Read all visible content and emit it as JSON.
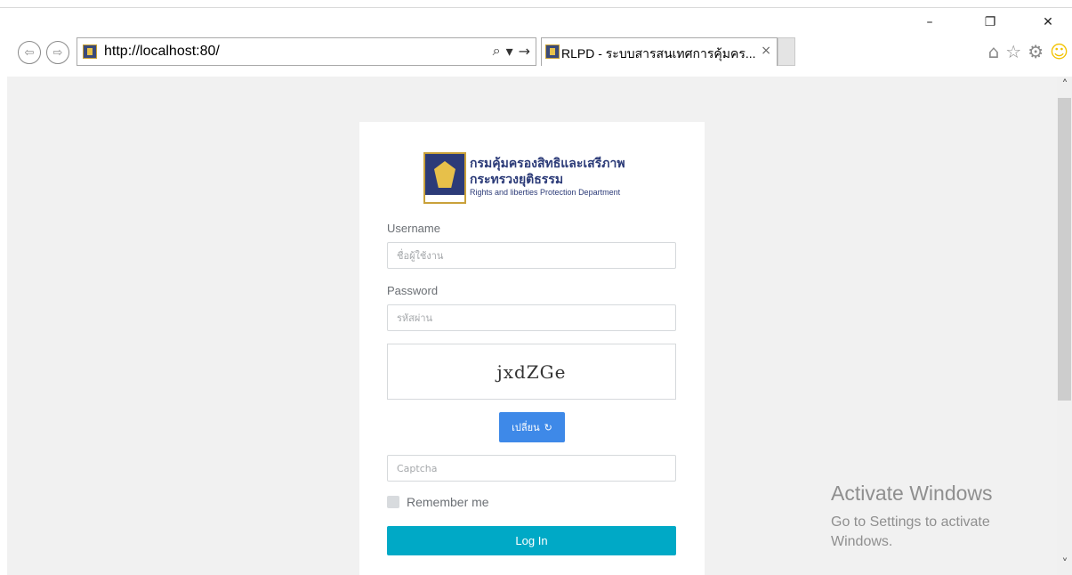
{
  "window": {
    "minimize": "–",
    "restore": "❐",
    "close": "✕"
  },
  "browser": {
    "back_icon": "⇦",
    "forward_icon": "⇨",
    "address": "http://localhost:80/",
    "search_icon": "⌕",
    "dropdown_icon": "▾",
    "go_icon": "→",
    "tab_title": "RLPD - ระบบสารสนเทศการคุ้มคร...",
    "tab_close": "×",
    "icons": [
      "home-icon",
      "star-icon",
      "gear-icon",
      "smiley-icon"
    ]
  },
  "scrollbar": {
    "up": "˄",
    "down": "˅"
  },
  "logo": {
    "line1": "กรมคุ้มครองสิทธิและเสรีภาพ",
    "line2": "กระทรวงยุติธรรม",
    "line3": "Rights and liberties Protection Department"
  },
  "form": {
    "username_label": "Username",
    "username_placeholder": "ชื่อผู้ใช้งาน",
    "password_label": "Password",
    "password_placeholder": "รหัสผ่าน",
    "captcha_image_text": "jxdZGe",
    "change_button": "เปลี่ยน",
    "refresh_icon": "↻",
    "captcha_placeholder": "Captcha",
    "remember_label": "Remember me",
    "login_button": "Log In"
  },
  "watermark": {
    "title": "Activate Windows",
    "subtitle": "Go to Settings to activate Windows."
  },
  "colors": {
    "page_bg": "#f1f1f1",
    "primary_button": "#3e89e8",
    "login_button": "#00a9c6"
  }
}
